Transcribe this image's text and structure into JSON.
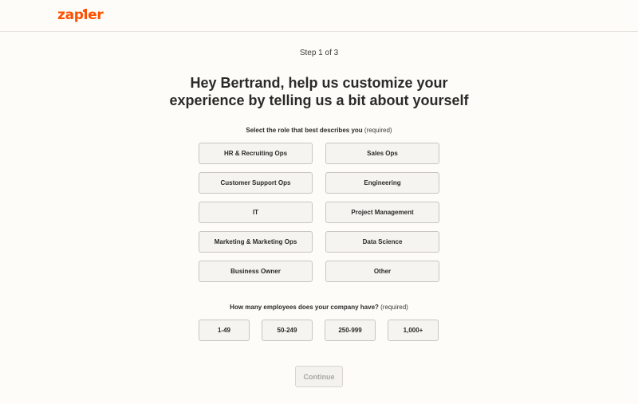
{
  "brand": {
    "logo_text": "zapier",
    "accent": "#ff4f00"
  },
  "step_indicator": "Step 1 of 3",
  "headline": {
    "line1": "Hey Bertrand, help us customize your",
    "line2": "experience by telling us a bit about yourself"
  },
  "role_question": {
    "label": "Select the role that best describes you",
    "required": "(required)",
    "options": [
      "HR & Recruiting Ops",
      "Sales Ops",
      "Customer Support Ops",
      "Engineering",
      "IT",
      "Project Management",
      "Marketing & Marketing Ops",
      "Data Science",
      "Business Owner",
      "Other"
    ]
  },
  "employee_question": {
    "label": "How many employees does your company have?",
    "required": "(required)",
    "options": [
      "1-49",
      "50-249",
      "250-999",
      "1,000+"
    ]
  },
  "continue_label": "Continue"
}
